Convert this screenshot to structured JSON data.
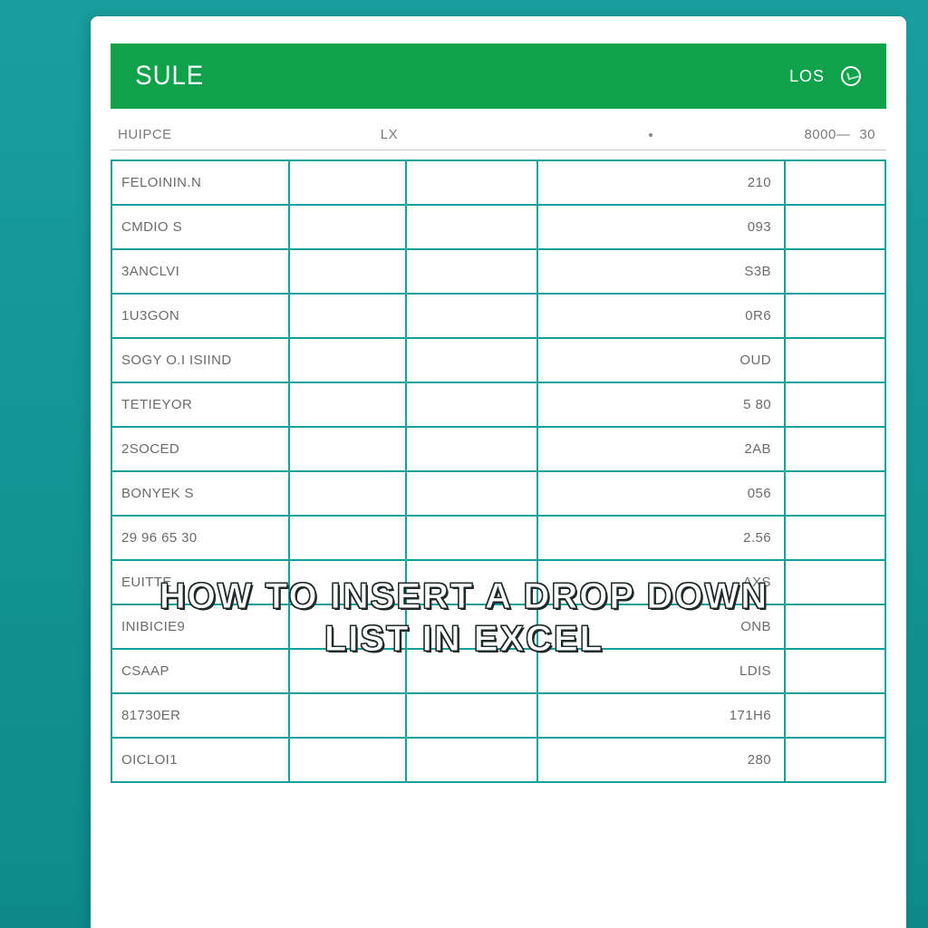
{
  "header": {
    "title": "SULE",
    "right_label": "LOS"
  },
  "subheader": {
    "label": "HUIPCE",
    "mid": "LX",
    "value1": "8000—",
    "value2": "30"
  },
  "rows": [
    {
      "c1": "FELOININ.N",
      "c4": "210"
    },
    {
      "c1": "CMDIO S",
      "c4": "093"
    },
    {
      "c1": "3ANCLVI",
      "c4": "S3B"
    },
    {
      "c1": "1U3GON",
      "c4": "0R6"
    },
    {
      "c1": "SOGY O.I ISIIND",
      "c4": "OUD"
    },
    {
      "c1": "TETIEYOR",
      "c4": "5 80"
    },
    {
      "c1": "2SOCED",
      "c4": "2AB"
    },
    {
      "c1": "BONYEK S",
      "c4": "056"
    },
    {
      "c1": "29 96 65 30",
      "c4": "2.56"
    },
    {
      "c1": "EUITTE",
      "c4": "AXS"
    },
    {
      "c1": "INIBICIE9",
      "c4": "ONB"
    },
    {
      "c1": "Csaap",
      "c4": "LDIS"
    },
    {
      "c1": "81730ER",
      "c4": "171H6"
    },
    {
      "c1": "OICLOI1",
      "c4": "280"
    }
  ],
  "overlay": {
    "line1": "How To Insert A Drop Down",
    "line2": "List In Excel"
  }
}
